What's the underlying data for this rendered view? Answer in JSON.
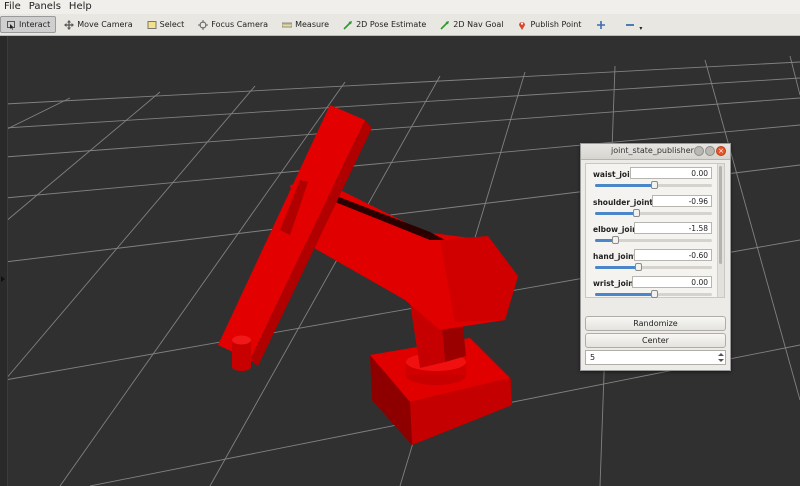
{
  "menu": {
    "file": "File",
    "panels": "Panels",
    "help": "Help"
  },
  "toolbar": {
    "interact": "Interact",
    "move_camera": "Move Camera",
    "select": "Select",
    "focus_camera": "Focus Camera",
    "measure": "Measure",
    "pose_estimate": "2D Pose Estimate",
    "nav_goal": "2D Nav Goal",
    "publish_point": "Publish Point"
  },
  "panel": {
    "title": "joint_state_publisher",
    "joints": [
      {
        "name": "waist_joint",
        "value": "0.00",
        "position": 0.5
      },
      {
        "name": "shoulder_joint",
        "value": "-0.96",
        "position": 0.35
      },
      {
        "name": "elbow_joint",
        "value": "-1.58",
        "position": 0.17
      },
      {
        "name": "hand_joint",
        "value": "-0.60",
        "position": 0.37
      },
      {
        "name": "wrist_joint",
        "value": "0.00",
        "position": 0.5
      }
    ],
    "randomize_label": "Randomize",
    "center_label": "Center",
    "spin_value": "5"
  },
  "colors": {
    "robot": "#e00000",
    "background": "#303030",
    "grid": "#9a9a9a",
    "slider_accent": "#4a86c8"
  }
}
